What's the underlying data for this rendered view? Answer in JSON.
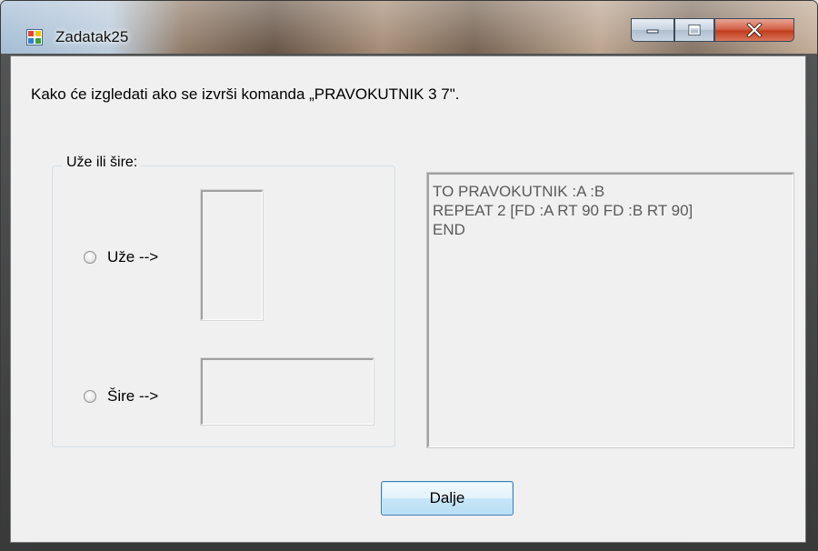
{
  "window": {
    "title": "Zadatak25"
  },
  "question": "Kako će izgledati ako se izvrši komanda „PRAVOKUTNIK 3 7\".",
  "group": {
    "legend": "Uže ili šire:",
    "options": [
      {
        "label": "Uže -->",
        "checked": false
      },
      {
        "label": "Šire -->",
        "checked": false
      }
    ]
  },
  "code": {
    "lines": [
      "TO PRAVOKUTNIK :A :B",
      "REPEAT 2 [FD :A RT 90 FD :B RT 90]",
      "END"
    ]
  },
  "buttons": {
    "next_label": "Dalje"
  },
  "icons": {
    "app": "application-window-icon",
    "minimize": "minimize-icon",
    "maximize": "maximize-icon",
    "close": "close-icon"
  },
  "colors": {
    "client_bg": "#f0f0f0",
    "code_text": "#5a5a5a",
    "close_red": "#c23d1e",
    "button_border": "#3c7fb1"
  }
}
